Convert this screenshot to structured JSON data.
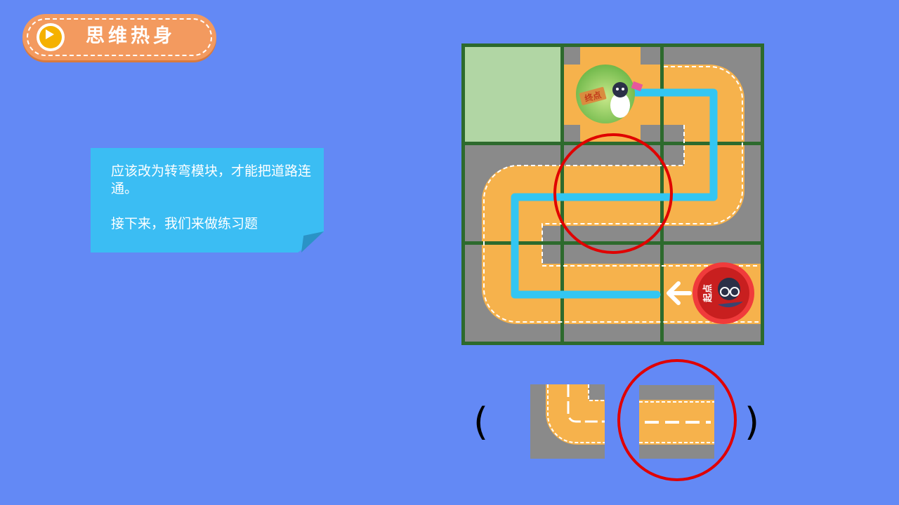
{
  "header": {
    "title": "思维热身",
    "icon": "play-icon"
  },
  "note": {
    "line1": "应该改为转弯模块，才能把道路连通。",
    "line2": "接下来，我们来做练习题"
  },
  "board": {
    "end_label": "终点",
    "start_label": "起点",
    "route_color": "#33c6f2",
    "road_color": "#f6b24c",
    "highlight_color": "#e00000"
  },
  "answer": {
    "open_paren": "(",
    "close_paren": ")",
    "options": [
      "curve-tile",
      "straight-tile"
    ],
    "selected": "straight-tile"
  }
}
